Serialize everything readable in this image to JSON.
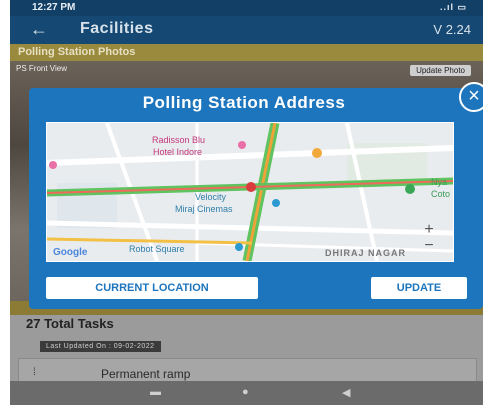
{
  "status_bar": {
    "time": "12:27 PM",
    "signal": "..ıl ▭"
  },
  "app_bar": {
    "title": "Facilities",
    "version": "V 2.24"
  },
  "section_header": "Polling Station Photos",
  "photo": {
    "view_label": "PS Front View",
    "update_button": "Update Photo"
  },
  "dialog": {
    "title": "Polling Station Address",
    "close": "×",
    "map": {
      "labels": [
        "Radisson Blu",
        "Hotel Indore",
        "Velocity",
        "Miraj Cinemas",
        "Robot Square",
        "DHIRAJ NAGAR",
        "Nya",
        "Coto"
      ],
      "brand": "Google",
      "zoom_in": "+",
      "zoom_out": "−"
    },
    "current_location_button": "CURRENT LOCATION",
    "update_button": "UPDATE"
  },
  "tasks": {
    "total": "27 Total Tasks",
    "last_updated": "Last Updated On : 09-02-2022"
  },
  "task_item": {
    "label": "Permanent ramp"
  },
  "colors": {
    "dialog": "#1c75bd",
    "app_bar": "#154872",
    "section": "#9a8a3e"
  }
}
